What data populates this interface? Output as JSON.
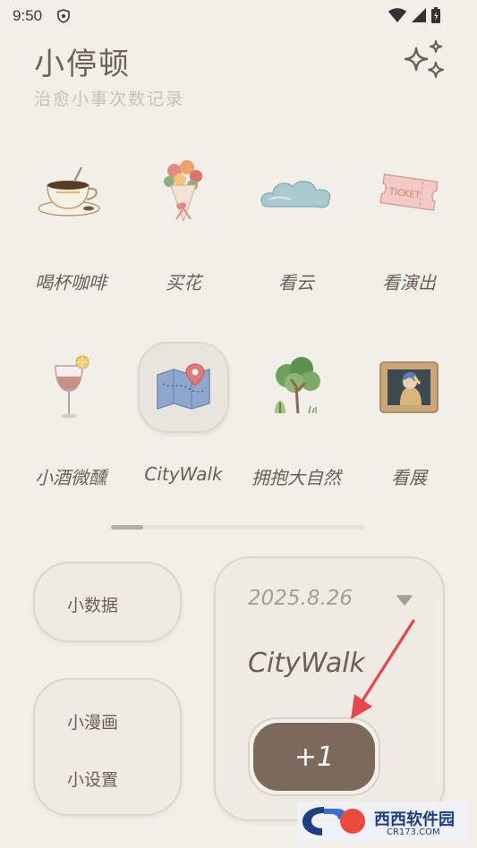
{
  "status_bar": {
    "time": "9:50"
  },
  "header": {
    "title": "小停顿",
    "subtitle": "治愈小事次数记录"
  },
  "activities": [
    {
      "label": "喝杯咖啡",
      "icon": "coffee-cup-icon"
    },
    {
      "label": "买花",
      "icon": "bouquet-icon"
    },
    {
      "label": "看云",
      "icon": "cloud-icon"
    },
    {
      "label": "看演出",
      "icon": "ticket-icon"
    },
    {
      "label": "小酒微醺",
      "icon": "wine-glass-icon"
    },
    {
      "label": "CityWalk",
      "icon": "map-icon",
      "selected": true
    },
    {
      "label": "拥抱大自然",
      "icon": "tree-icon"
    },
    {
      "label": "看展",
      "icon": "framed-painting-icon"
    }
  ],
  "pager": {
    "page": 1,
    "pages": 2
  },
  "menu": {
    "data_label": "小数据",
    "comic_label": "小漫画",
    "settings_label": "小设置"
  },
  "counter": {
    "date": "2025.8.26",
    "activity": "CityWalk",
    "button_label": "+1"
  },
  "watermark": {
    "brand": "西西软件园",
    "url": "CR173.COM"
  },
  "colors": {
    "background": "#f2efe9",
    "accent": "#7b6a5c",
    "text": "#6b5e53",
    "annotation": "#e8454a"
  }
}
